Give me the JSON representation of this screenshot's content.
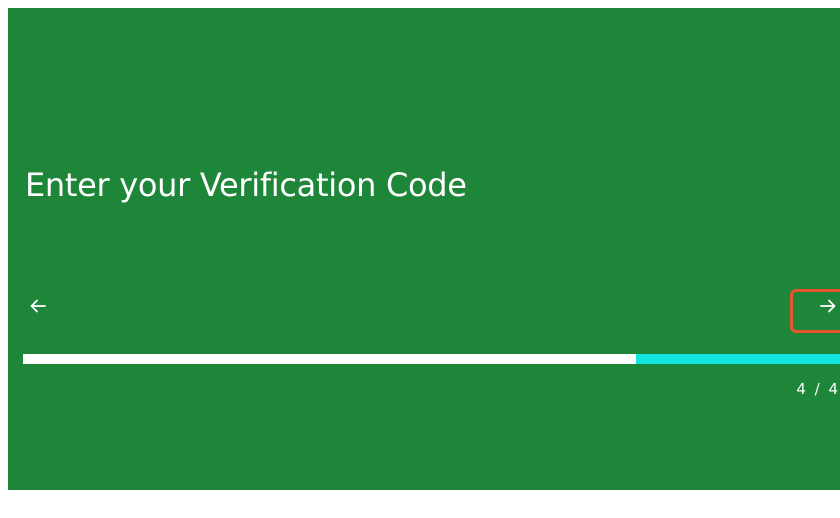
{
  "step": {
    "title": "Enter your Verification Code",
    "counter": "4 / 4",
    "progress_white_fraction": 0.75
  },
  "nav": {
    "prev_icon": "arrow-left-icon",
    "next_icon": "arrow-right-icon"
  },
  "colors": {
    "background": "#1e8638",
    "progress_filled": "#ffffff",
    "progress_remaining": "#12e5e0",
    "highlight": "#e8542f"
  }
}
